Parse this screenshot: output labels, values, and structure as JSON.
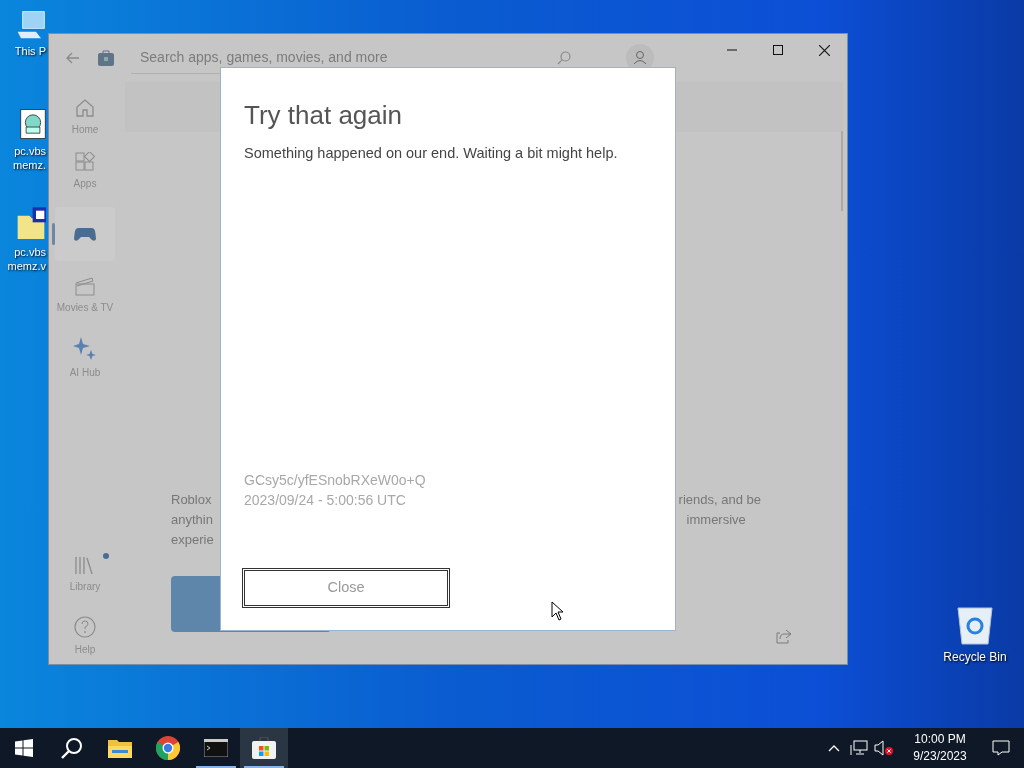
{
  "desktop_icons": [
    {
      "label": "This P",
      "kind": "pc"
    },
    {
      "label": "pc.vbs memz.",
      "kind": "script"
    },
    {
      "label": "pc.vbs memz.v",
      "kind": "folder"
    },
    {
      "label": "Recycle Bin",
      "kind": "bin"
    }
  ],
  "store_window": {
    "search": {
      "placeholder": "Search apps, games, movies, and more"
    },
    "nav": [
      {
        "label": "Home",
        "kind": "home",
        "selected": false,
        "badge": false
      },
      {
        "label": "Apps",
        "kind": "apps",
        "selected": false,
        "badge": false
      },
      {
        "kind": "gaming",
        "selected": true,
        "badge": false
      },
      {
        "label": "Movies & TV",
        "kind": "movies",
        "selected": false,
        "badge": false
      },
      {
        "label": "AI Hub",
        "kind": "ai",
        "selected": false,
        "badge": false
      },
      {
        "label": "Library",
        "kind": "library",
        "selected": false,
        "badge": true
      },
      {
        "label": "Help",
        "kind": "help",
        "selected": false,
        "badge": false
      }
    ],
    "description_left": [
      "Roblox",
      "anythin",
      "experie"
    ],
    "description_right": [
      "riends, and be",
      "immersive"
    ]
  },
  "dialog": {
    "title": "Try that again",
    "message": "Something happened on our end. Waiting a bit might help.",
    "code": "GCsy5c/yfESnobRXeW0o+Q",
    "timestamp": "2023/09/24 - 5:00:56 UTC",
    "button": "Close"
  },
  "taskbar": {
    "apps": [
      {
        "kind": "start",
        "running": false,
        "selected": false
      },
      {
        "kind": "search",
        "running": false,
        "selected": false
      },
      {
        "kind": "explorer",
        "running": false,
        "selected": false
      },
      {
        "kind": "chrome",
        "running": false,
        "selected": false
      },
      {
        "kind": "terminal",
        "running": true,
        "selected": false
      },
      {
        "kind": "store",
        "running": true,
        "selected": true
      }
    ],
    "time": "10:00 PM",
    "date": "9/23/2023"
  }
}
